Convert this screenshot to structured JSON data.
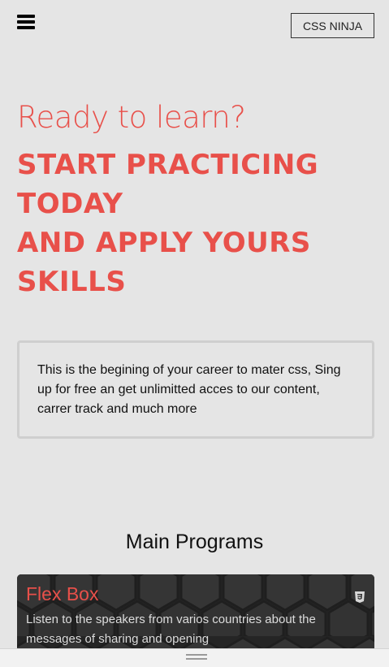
{
  "header": {
    "menu_icon": "hamburger-menu-icon",
    "brand_label": "CSS NINJA"
  },
  "hero": {
    "subtitle": "Ready to learn?",
    "title_lines": [
      "START PRACTICING",
      "TODAY",
      "AND APPLY YOURS",
      "SKILLS"
    ]
  },
  "intro": {
    "text": "This is the begining of your career to mater css, Sing up for free an get unlimitted acces to our content, carrer track and much more"
  },
  "programs": {
    "heading": "Main Programs",
    "items": [
      {
        "title": "Flex Box",
        "icon": "css3-icon",
        "description": "Listen to the speakers from varios countries about the messages of sharing and opening"
      }
    ]
  },
  "bottom_bar": {
    "handle_icon": "drag-handle-icon"
  },
  "colors": {
    "accent": "#e8504a",
    "background": "#e5e5e5",
    "card_background": "#2b2b2b"
  }
}
